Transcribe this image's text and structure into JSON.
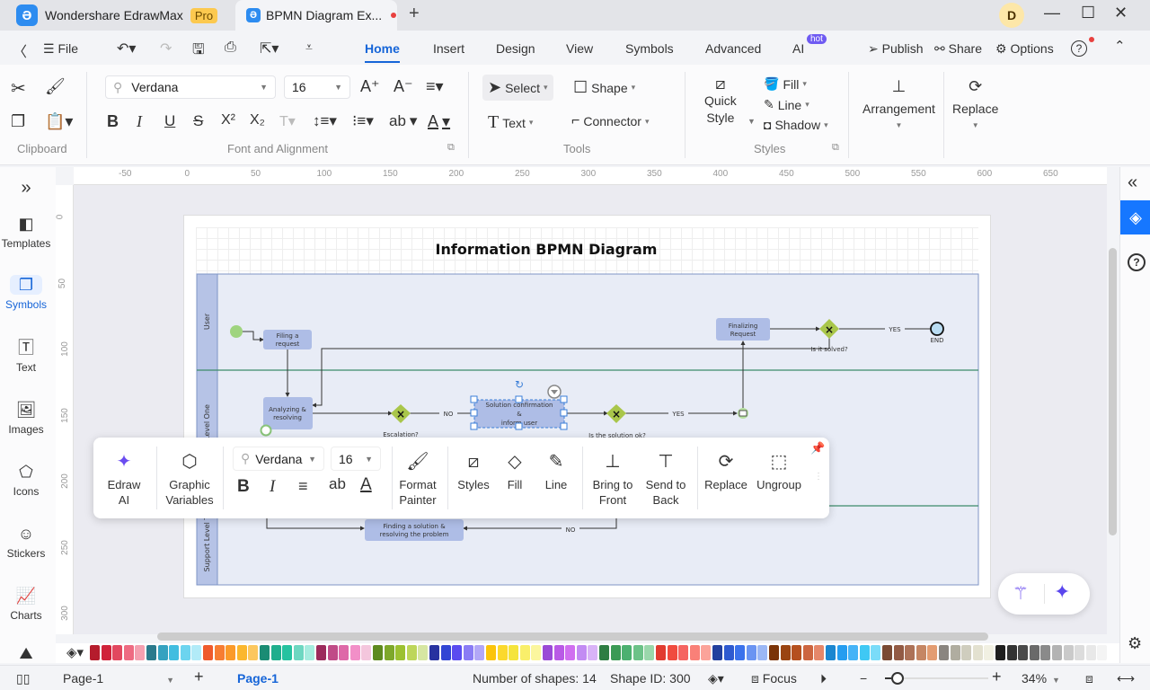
{
  "titlebar": {
    "app_name": "Wondershare EdrawMax",
    "pro_badge": "Pro",
    "doc_tab": "BPMN Diagram Ex...",
    "new_tab": "+",
    "avatar_letter": "D",
    "minimize": "—",
    "maximize": "☐",
    "close": "✕"
  },
  "menubar": {
    "back": "〈",
    "file": "File",
    "tabs": [
      {
        "label": "Home",
        "active": true
      },
      {
        "label": "Insert"
      },
      {
        "label": "Design"
      },
      {
        "label": "View"
      },
      {
        "label": "Symbols"
      },
      {
        "label": "Advanced"
      },
      {
        "label": "AI"
      }
    ],
    "ai_badge": "hot",
    "publish": "Publish",
    "share": "Share",
    "options": "Options",
    "help": "?"
  },
  "ribbon": {
    "clipboard": {
      "label": "Clipboard"
    },
    "font": {
      "family": "Verdana",
      "size": "16",
      "label": "Font and Alignment",
      "bold": "B",
      "italic": "I",
      "underline": "U",
      "strike": "S",
      "superscript": "X²",
      "subscript": "X₂",
      "ab": "ab",
      "font_color": "A"
    },
    "tools": {
      "select": "Select",
      "shape": "Shape",
      "text": "Text",
      "connector": "Connector",
      "label": "Tools"
    },
    "styles": {
      "quick_style_1": "Quick",
      "quick_style_2": "Style",
      "fill": "Fill",
      "line": "Line",
      "shadow": "Shadow",
      "label": "Styles"
    },
    "arrangement": "Arrangement",
    "replace": "Replace"
  },
  "leftbar": {
    "items": [
      {
        "label": "Templates"
      },
      {
        "label": "Symbols",
        "active": true
      },
      {
        "label": "Text"
      },
      {
        "label": "Images"
      },
      {
        "label": "Icons"
      },
      {
        "label": "Stickers"
      },
      {
        "label": "Charts"
      }
    ]
  },
  "rulers": {
    "h": [
      "-50",
      "0",
      "50",
      "100",
      "150",
      "200",
      "250",
      "300",
      "350",
      "400",
      "450",
      "500",
      "550",
      "600",
      "650"
    ],
    "v": [
      "0",
      "50",
      "100",
      "150",
      "200",
      "250",
      "300"
    ]
  },
  "diagram": {
    "title": "Information BPMN Diagram",
    "lanes": [
      "User",
      "Level One",
      "Support Level Two"
    ],
    "nodes": {
      "filing": [
        "Filing a",
        "request"
      ],
      "analyzing": [
        "Analyzing &",
        "resolving"
      ],
      "solution": [
        "Solution confirmation",
        "&",
        "inform user"
      ],
      "finalizing": [
        "Finalizing",
        "Request"
      ],
      "finding": [
        "Finding a solution &",
        "resolving the problem"
      ],
      "end": "END"
    },
    "gateways": {
      "escalation": "Escalation?",
      "solution_ok": "Is the solution ok?",
      "solved": "Is it solved?"
    },
    "edge_labels": {
      "no1": "NO",
      "yes1": "YES",
      "yes2": "YES",
      "no2": "NO"
    }
  },
  "floating_toolbar": {
    "edraw_ai": "Edraw AI",
    "graphic_vars": [
      "Graphic",
      "Variables"
    ],
    "font": "Verdana",
    "size": "16",
    "bold": "B",
    "italic": "I",
    "ab": "ab",
    "font_color": "A",
    "format_painter": [
      "Format",
      "Painter"
    ],
    "styles": "Styles",
    "fill": "Fill",
    "line": "Line",
    "bring_front": [
      "Bring to",
      "Front"
    ],
    "send_back": [
      "Send to",
      "Back"
    ],
    "replace": "Replace",
    "ungroup": "Ungroup"
  },
  "palette": [
    "#b51c2c",
    "#d0223a",
    "#e2485f",
    "#ee6b82",
    "#f4a0b0",
    "#2a7a8c",
    "#34a2c0",
    "#41bde0",
    "#6cd4ef",
    "#b2ebf8",
    "#ef5a2c",
    "#f77d33",
    "#fb9a2a",
    "#fbb72e",
    "#fcc75e",
    "#1a8c74",
    "#1eae8d",
    "#25c2a0",
    "#6dd7c1",
    "#a6ecdf",
    "#9c2a5c",
    "#c04b87",
    "#de68a8",
    "#f28fc8",
    "#f4c6dd",
    "#5e8a1f",
    "#7ea82a",
    "#9cc131",
    "#bdd65a",
    "#d6e6a2",
    "#2732a0",
    "#3145d4",
    "#5a4cf0",
    "#8a7cf5",
    "#b2a7f7",
    "#fbc40b",
    "#fbd92d",
    "#f5e43c",
    "#f9ef6a",
    "#fbf69e",
    "#9a4ad6",
    "#b95ae6",
    "#d06ff0",
    "#c28bf3",
    "#d9b3f7",
    "#2e7d43",
    "#3b9a55",
    "#4cb070",
    "#6cc288",
    "#9ad7ab",
    "#e13b30",
    "#f04b3f",
    "#f56461",
    "#f98078",
    "#fba39a",
    "#223f9e",
    "#2e5ad0",
    "#3b72ec",
    "#6a94f2",
    "#9bb7f5",
    "#7a3308",
    "#9a4412",
    "#b5501f",
    "#cc6540",
    "#e5876a",
    "#1a86d0",
    "#259df0",
    "#45b3f7",
    "#3fc8f4",
    "#7adcf9",
    "#7a4a34",
    "#925a44",
    "#ad7258",
    "#c58664",
    "#e39c72",
    "#8a8580",
    "#b0ada0",
    "#cfcdbe",
    "#e3e1d0",
    "#f1f0e2",
    "#1e1e1e",
    "#333",
    "#4a4a4a",
    "#6a6a6a",
    "#8a8a8a",
    "#b3b3b3",
    "#cacaca",
    "#dcdcdc",
    "#e8e8e8",
    "#f4f4f4"
  ],
  "statusbar": {
    "page_select": "Page-1",
    "add_page": "+",
    "active_page": "Page-1",
    "num_shapes": "Number of shapes: 14",
    "shape_id": "Shape ID: 300",
    "focus": "Focus",
    "zoom_minus": "−",
    "zoom_plus": "+",
    "zoom_level": "34%",
    "zoom_fraction": 0.34
  }
}
